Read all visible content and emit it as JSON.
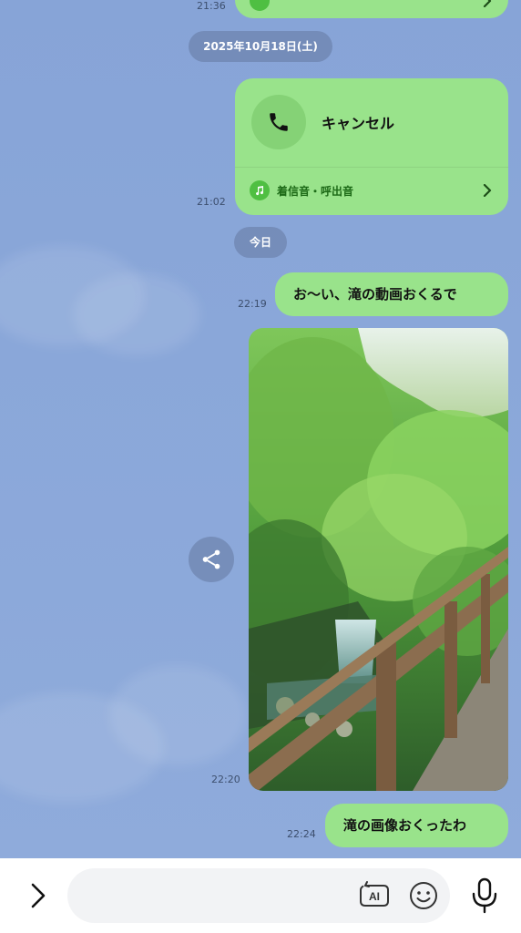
{
  "messages": {
    "top_partial_time": "21:36",
    "date_divider_1": "2025年10月18日(土)",
    "call": {
      "label": "キャンセル",
      "ringtone_label": "着信音・呼出音",
      "time": "21:02"
    },
    "date_divider_2": "今日",
    "text_1": {
      "text": "お〜い、滝の動画おくるで",
      "time": "22:19"
    },
    "photo": {
      "time": "22:20"
    },
    "text_2": {
      "text": "滝の画像おくったわ",
      "time": "22:24"
    }
  },
  "input_bar": {
    "ai_label": "AI"
  },
  "colors": {
    "chat_background": "#8ba8d8",
    "bubble_green": "#99e38b",
    "date_pill": "#6478a0"
  },
  "icons": [
    "phone-icon",
    "music-note-icon",
    "chevron-right-icon",
    "share-icon",
    "chevron-right-expand-icon",
    "ai-icon",
    "emoji-icon",
    "microphone-icon"
  ]
}
